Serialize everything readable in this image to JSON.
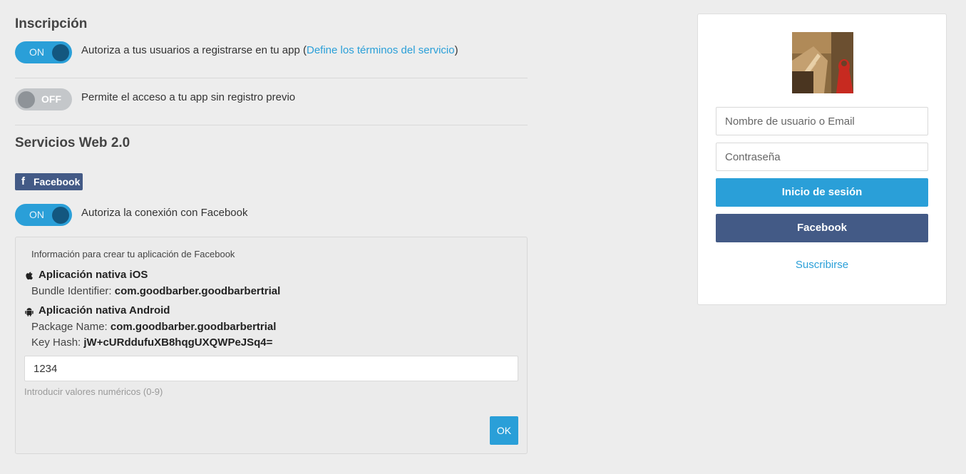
{
  "registration": {
    "title": "Inscripción",
    "signup_toggle": "ON",
    "signup_text": "Autoriza a tus usuarios a registrarse en tu app (",
    "signup_link": "Define los términos del servicio",
    "signup_text_end": ")",
    "guest_toggle": "OFF",
    "guest_text": "Permite el acceso a tu app sin registro previo"
  },
  "web_services": {
    "title": "Servicios Web 2.0",
    "facebook_badge": "Facebook",
    "facebook_toggle": "ON",
    "facebook_text": "Autoriza la conexión con Facebook",
    "panel": {
      "info": "Información para crear tu aplicación de Facebook",
      "ios_heading": "Aplicación nativa iOS",
      "bundle_label": "Bundle Identifier: ",
      "bundle_value": "com.goodbarber.goodbarbertrial",
      "android_heading": "Aplicación nativa Android",
      "package_label": "Package Name: ",
      "package_value": "com.goodbarber.goodbarbertrial",
      "keyhash_label": "Key Hash: ",
      "keyhash_value": "jW+cURddufuXB8hqgUXQWPeJSq4=",
      "input_value": "1234",
      "hint": "Introducir valores numéricos (0-9)",
      "ok_label": "OK"
    }
  },
  "login_preview": {
    "username_placeholder": "Nombre de usuario o Email",
    "password_placeholder": "Contraseña",
    "login_button": "Inicio de sesión",
    "facebook_button": "Facebook",
    "subscribe_link": "Suscribirse"
  },
  "colors": {
    "accent": "#2a9fd8",
    "facebook": "#435a86",
    "background": "#ededed"
  }
}
